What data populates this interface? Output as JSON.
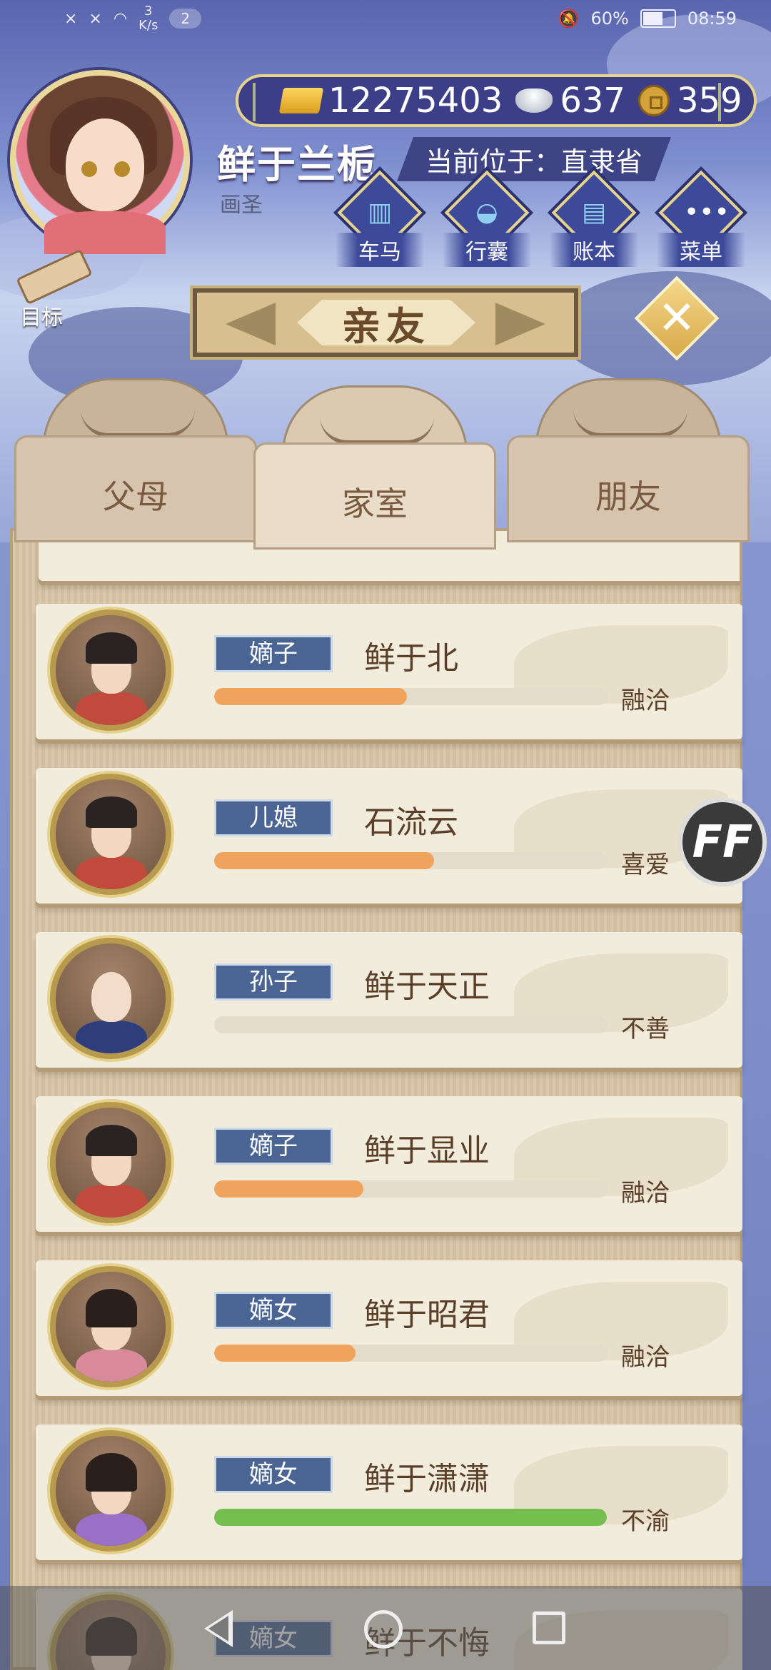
{
  "status_bar": {
    "signal_1": "×",
    "signal_2": "×",
    "net_speed_value": "3",
    "net_speed_unit": "K/s",
    "notif_count": "2",
    "battery": "60%",
    "time": "08:59"
  },
  "currency": {
    "gold": "12275403",
    "silver": "637",
    "coins": "359"
  },
  "player": {
    "name": "鲜于兰栀",
    "title": "画圣",
    "location": "当前位于：直隶省"
  },
  "nav": {
    "carriage": "车马",
    "bag": "行囊",
    "ledger": "账本",
    "menu": "菜单"
  },
  "goal_label": "目标",
  "panel_title": "亲友",
  "close_label": "✕",
  "tabs": [
    {
      "label": "父母"
    },
    {
      "label": "家室"
    },
    {
      "label": "朋友"
    }
  ],
  "active_tab": "家室",
  "members": [
    {
      "relation": "嫡子",
      "name": "鲜于北",
      "status": "融洽",
      "affinity": 0.49,
      "bar_color": "#f0a35c"
    },
    {
      "relation": "儿媳",
      "name": "石流云",
      "status": "喜爱",
      "affinity": 0.56,
      "bar_color": "#f0a35c"
    },
    {
      "relation": "孙子",
      "name": "鲜于天正",
      "status": "不善",
      "affinity": 0.0,
      "bar_color": "#f0a35c"
    },
    {
      "relation": "嫡子",
      "name": "鲜于显业",
      "status": "融洽",
      "affinity": 0.38,
      "bar_color": "#f0a35c"
    },
    {
      "relation": "嫡女",
      "name": "鲜于昭君",
      "status": "融洽",
      "affinity": 0.36,
      "bar_color": "#f0a35c"
    },
    {
      "relation": "嫡女",
      "name": "鲜于潇潇",
      "status": "不渝",
      "affinity": 1.0,
      "bar_color": "#74bf4f"
    },
    {
      "relation": "嫡女",
      "name": "鲜于不悔",
      "status": "",
      "affinity": 0.0,
      "bar_color": "#f0a35c"
    }
  ],
  "ff_label": "FF"
}
